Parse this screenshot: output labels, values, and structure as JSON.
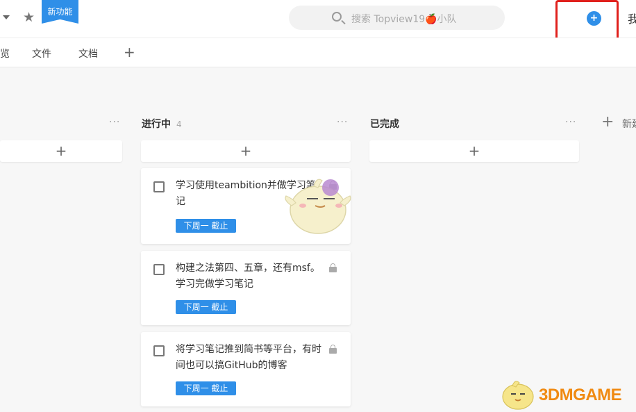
{
  "header": {
    "new_feature_label": "新功能",
    "search_placeholder": "搜索 Topview19🍎小队",
    "add_button_glyph": "+",
    "me_label": "我"
  },
  "tabs": [
    {
      "label": "览"
    },
    {
      "label": "文件"
    },
    {
      "label": "文档"
    }
  ],
  "tab_add_glyph": "+",
  "columns": [
    {
      "title": "",
      "count": ""
    },
    {
      "title": "进行中",
      "count": "4"
    },
    {
      "title": "已完成",
      "count": ""
    }
  ],
  "more_glyph": "···",
  "add_glyph": "+",
  "new_column_label": "新建",
  "tasks": [
    {
      "title": "学习使用teambition并做学习笔记",
      "due": "下周一 截止",
      "locked": true
    },
    {
      "title": "构建之法第四、五章，还有msf。学习完做学习笔记",
      "due": "下周一 截止",
      "locked": true
    },
    {
      "title": "将学习笔记推到简书等平台，有时间也可以搞GitHub的博客",
      "due": "下周一 截止",
      "locked": true
    }
  ],
  "watermark": {
    "text": "3DMGAME"
  },
  "colors": {
    "accent": "#2f8fe8",
    "highlight": "#e0201c",
    "watermark": "#f08a12"
  }
}
